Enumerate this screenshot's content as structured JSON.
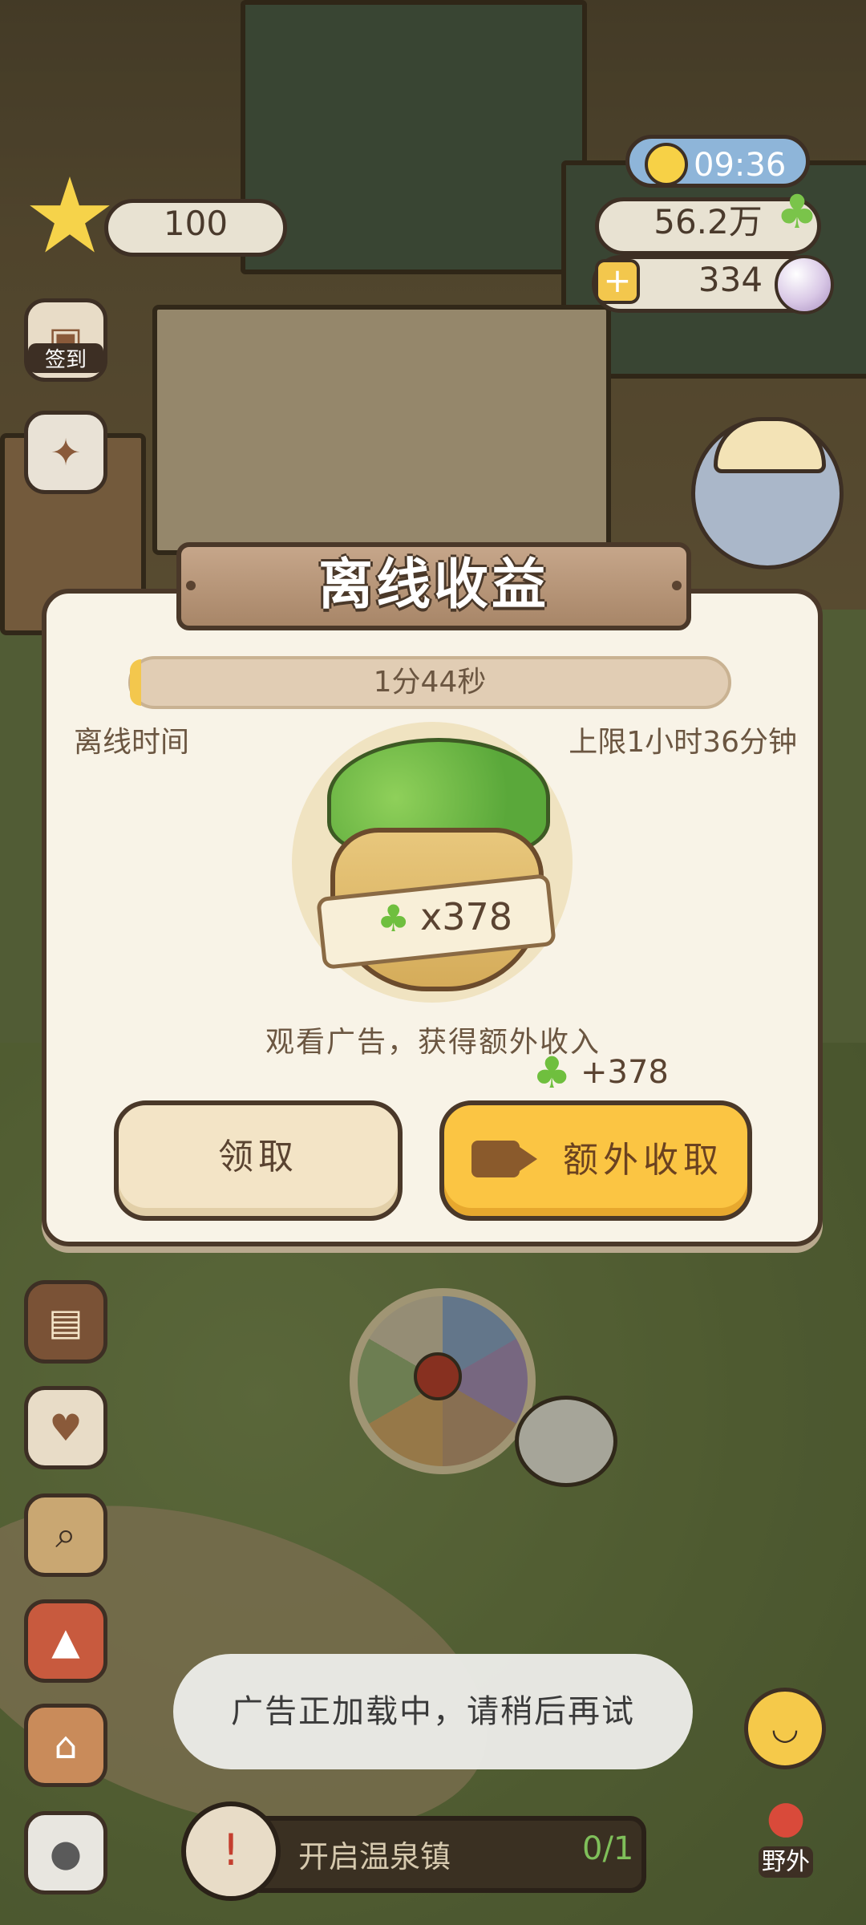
{
  "hud": {
    "stars": "100",
    "time": "09:36",
    "money": "56.2万",
    "gems": "334",
    "checkin_label": "签到",
    "field_label": "野外"
  },
  "modal": {
    "title": "离线收益",
    "offline_duration": "1分44秒",
    "offline_label": "离线时间",
    "limit_label": "上限1小时36分钟",
    "progress_fraction": 0.018,
    "reward_amount": "x378",
    "ad_hint": "观看广告，获得额外收入",
    "bonus_amount": "+378",
    "claim_label": "领取",
    "extra_claim_label": "额外收取"
  },
  "quest": {
    "title": "开启温泉镇",
    "progress": "0/1"
  },
  "toast": {
    "message": "广告正加载中，请稍后再试"
  },
  "colors": {
    "accent": "#fbc543",
    "panel": "#f8f3e7",
    "border": "#4a3829",
    "bamboo": "#6fbf3e"
  },
  "icons": [
    "star-icon",
    "checkin-icon",
    "sun-icon",
    "bamboo-icon",
    "plus-icon",
    "pearl-icon",
    "video-icon",
    "map-pin-icon",
    "emoji-icon",
    "quest-icon"
  ]
}
